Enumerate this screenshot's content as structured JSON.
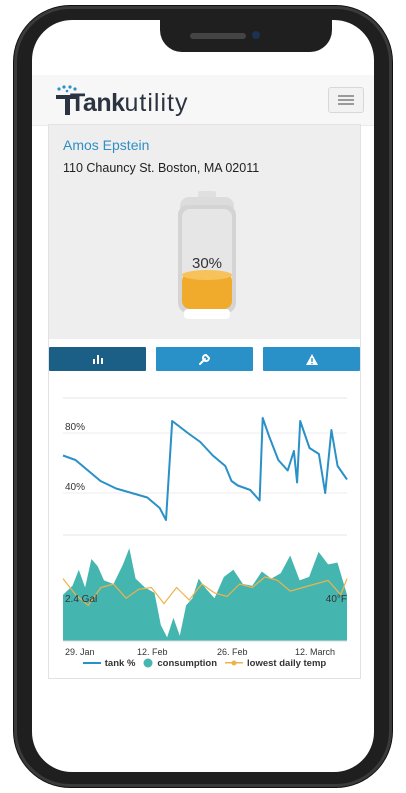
{
  "brand": {
    "name_bold": "Tank",
    "name_light": "utility"
  },
  "customer": {
    "name": "Amos Epstein",
    "address": "110 Chauncy St. Boston, MA 02011"
  },
  "tank": {
    "level_percent": 30,
    "label": "30%"
  },
  "actions": [
    {
      "name": "stats",
      "icon": "bar-chart-icon",
      "active": true
    },
    {
      "name": "settings",
      "icon": "wrench-icon",
      "active": false
    },
    {
      "name": "alerts",
      "icon": "warning-icon",
      "active": false
    }
  ],
  "colors": {
    "accent": "#2a90c8",
    "accent_dark": "#1c5f86",
    "line": "#2a90c8",
    "consumption": "#45b5b0",
    "temp": "#f0b24a",
    "tank_fill": "#f0aa2c"
  },
  "chart_data": [
    {
      "type": "line",
      "title": "",
      "ylabel": "",
      "y_ticks": [
        "80%",
        "40%"
      ],
      "y_tick_values": [
        80,
        40
      ],
      "ylim": [
        20,
        100
      ],
      "series": [
        {
          "name": "tank %",
          "x": [
            0,
            4,
            8,
            12,
            17,
            22,
            27,
            31,
            33,
            35,
            40,
            44,
            48,
            52,
            54,
            56,
            60,
            63,
            64,
            66,
            69,
            72,
            74,
            75,
            76,
            79,
            82,
            84,
            86,
            88,
            91
          ],
          "values": [
            65,
            62,
            55,
            48,
            43,
            40,
            37,
            30,
            22,
            88,
            80,
            74,
            65,
            58,
            48,
            45,
            42,
            35,
            90,
            78,
            62,
            55,
            68,
            47,
            88,
            70,
            66,
            40,
            82,
            58,
            49
          ]
        }
      ]
    },
    {
      "type": "area",
      "title": "",
      "x_ticks": [
        "29. Jan",
        "12. Feb",
        "26. Feb",
        "12. March"
      ],
      "left_label": "2.4 Gal",
      "right_label": "40°F",
      "series": [
        {
          "name": "consumption",
          "x": [
            0,
            3,
            5,
            7,
            9,
            11,
            13,
            16,
            19,
            21,
            23,
            26,
            29,
            31,
            33,
            35,
            37,
            39,
            41,
            43,
            45,
            48,
            51,
            54,
            57,
            60,
            63,
            66,
            69,
            72,
            75,
            78,
            81,
            84,
            87,
            90
          ],
          "values": [
            2.6,
            3.1,
            4.0,
            3.0,
            4.6,
            4.2,
            3.4,
            3.2,
            4.3,
            5.2,
            3.5,
            3.0,
            2.7,
            0.9,
            0.2,
            1.3,
            0.3,
            2.0,
            2.4,
            3.5,
            3.0,
            2.4,
            3.6,
            4.0,
            3.2,
            3.1,
            3.9,
            3.5,
            3.8,
            4.8,
            3.4,
            3.6,
            5.0,
            4.3,
            4.4,
            2.6
          ]
        },
        {
          "name": "lowest daily temp",
          "x": [
            0,
            4,
            8,
            12,
            16,
            20,
            24,
            28,
            32,
            36,
            40,
            44,
            48,
            52,
            56,
            60,
            64,
            68,
            72,
            76,
            80,
            84,
            88,
            90
          ],
          "values": [
            3.5,
            2.6,
            2.0,
            3.0,
            3.2,
            2.4,
            2.9,
            3.0,
            2.1,
            3.0,
            2.3,
            3.2,
            2.7,
            2.5,
            3.2,
            3.0,
            3.6,
            3.4,
            2.8,
            3.0,
            3.2,
            3.4,
            2.6,
            3.5
          ]
        }
      ],
      "legend": [
        "tank %",
        "consumption",
        "lowest daily temp"
      ]
    }
  ]
}
